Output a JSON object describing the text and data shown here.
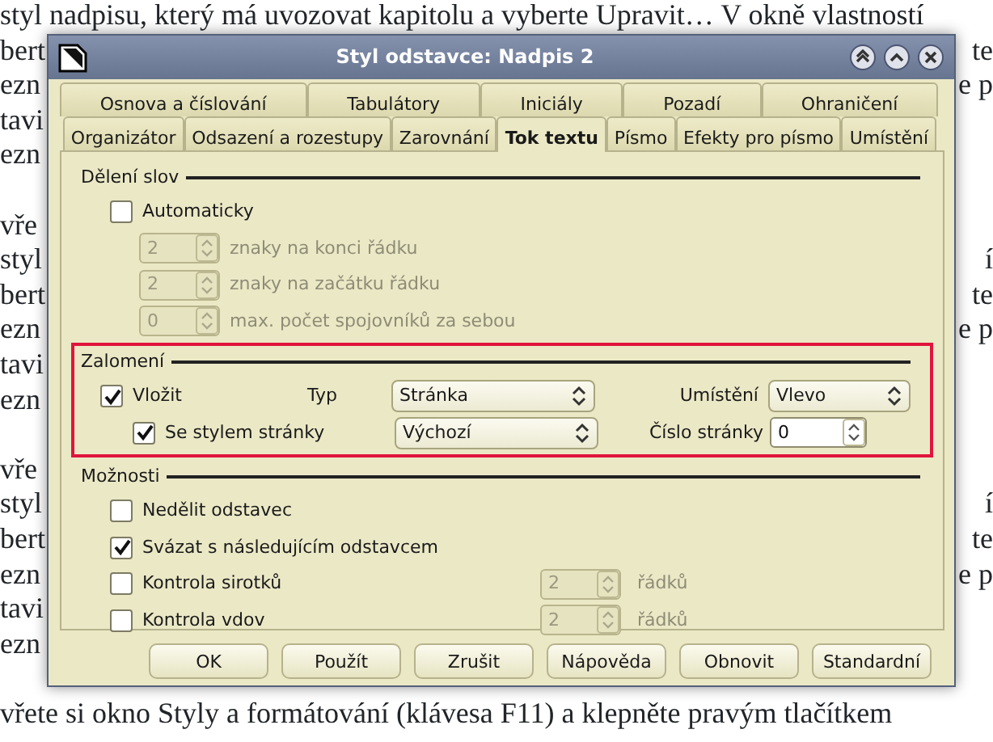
{
  "document": {
    "paragraphs": [
      [
        {
          "left": "styl nadpisu, který má uvozovat kapitolu a vyberte Upravit… V okně vlastností"
        },
        {
          "left": "bert",
          "right": "te"
        },
        {
          "left": "ezn",
          "right": "e p"
        },
        {
          "left": "tavi"
        },
        {
          "left": "ezn"
        }
      ],
      [
        {
          "left": "vře"
        },
        {
          "left": "styl",
          "right": "í"
        },
        {
          "left": "bert",
          "right": "te"
        },
        {
          "left": "ezn",
          "right": "e p"
        },
        {
          "left": "tavi"
        },
        {
          "left": "ezn"
        }
      ],
      [
        {
          "left": "vře"
        },
        {
          "left": "styl",
          "right": "í"
        },
        {
          "left": "bert",
          "right": "te"
        },
        {
          "left": "ezn",
          "right": "e p"
        },
        {
          "left": "tavi"
        },
        {
          "left": "ezn"
        }
      ],
      [
        {
          "left": "vřete si okno Styly a formátování (klávesa F11) a klepněte pravým tlačítkem"
        }
      ]
    ]
  },
  "dialog": {
    "title": "Styl odstavce: Nadpis 2",
    "tabs_row1": [
      {
        "label": "Osnova a číslování",
        "selected": false
      },
      {
        "label": "Tabulátory",
        "selected": false
      },
      {
        "label": "Iniciály",
        "selected": false
      },
      {
        "label": "Pozadí",
        "selected": false
      },
      {
        "label": "Ohraničení",
        "selected": false
      }
    ],
    "tabs_row2": [
      {
        "label": "Organizátor",
        "selected": false
      },
      {
        "label": "Odsazení a rozestupy",
        "selected": false
      },
      {
        "label": "Zarovnání",
        "selected": false
      },
      {
        "label": "Tok textu",
        "selected": true
      },
      {
        "label": "Písmo",
        "selected": false
      },
      {
        "label": "Efekty pro písmo",
        "selected": false
      },
      {
        "label": "Umístění",
        "selected": false
      }
    ],
    "hyphenation": {
      "title": "Dělení slov",
      "automatic": {
        "label": "Automaticky",
        "checked": false
      },
      "fields": [
        {
          "value": "2",
          "label": "znaky na konci řádku",
          "disabled": true
        },
        {
          "value": "2",
          "label": "znaky na začátku řádku",
          "disabled": true
        },
        {
          "value": "0",
          "label": "max. počet spojovníků za sebou",
          "disabled": true
        }
      ]
    },
    "breaks": {
      "title": "Zalomení",
      "highlighted": true,
      "insert": {
        "label": "Vložit",
        "checked": true
      },
      "type_label": "Typ",
      "type_value": "Stránka",
      "position_label": "Umístění",
      "position_value": "Vlevo",
      "with_page_style": {
        "label": "Se stylem stránky",
        "checked": true
      },
      "page_style_value": "Výchozí",
      "page_number_label": "Číslo stránky",
      "page_number_value": "0"
    },
    "options": {
      "title": "Možnosti",
      "items": [
        {
          "kind": "check",
          "label": "Nedělit odstavec",
          "checked": false
        },
        {
          "kind": "check",
          "label": "Svázat s následujícím odstavcem",
          "checked": true
        },
        {
          "kind": "check-spin",
          "label": "Kontrola sirotků",
          "checked": false,
          "value": "2",
          "unit": "řádků",
          "disabled": true
        },
        {
          "kind": "check-spin",
          "label": "Kontrola vdov",
          "checked": false,
          "value": "2",
          "unit": "řádků",
          "disabled": true
        }
      ]
    },
    "buttons": [
      "OK",
      "Použít",
      "Zrušit",
      "Nápověda",
      "Obnovit",
      "Standardní"
    ]
  }
}
